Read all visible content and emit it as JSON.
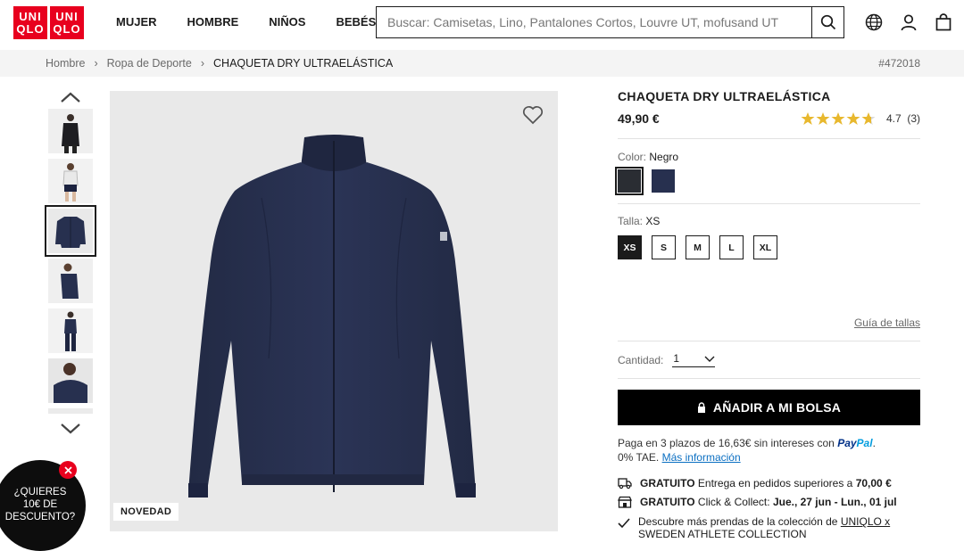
{
  "brand": {
    "line1": "UNI",
    "line2": "QLO",
    "line1_b": "UNI",
    "line2_b": "QLO",
    "color": "#e8001e"
  },
  "nav": [
    "MUJER",
    "HOMBRE",
    "NIÑOS",
    "BEBÉS"
  ],
  "search": {
    "placeholder": "Buscar: Camisetas, Lino, Pantalones Cortos, Louvre UT, mofusand UT"
  },
  "header_icons": [
    "globe-icon",
    "user-icon",
    "bag-icon"
  ],
  "breadcrumb": {
    "items": [
      "Hombre",
      "Ropa de Deporte",
      "CHAQUETA DRY ULTRAELÁSTICA"
    ],
    "code": "#472018"
  },
  "gallery": {
    "badge": "NOVEDAD",
    "selected_thumb": 3,
    "thumb_count": 7
  },
  "promo": {
    "line1": "¿QUIERES",
    "line2": "10€ DE",
    "line3": "DESCUENTO?"
  },
  "product": {
    "title": "CHAQUETA DRY ULTRAELÁSTICA",
    "price": "49,90 €",
    "rating": "4.7",
    "reviews": "(3)",
    "rating_value": 4.7,
    "color_label": "Color:",
    "color_value": "Negro",
    "colors": [
      "#2a2d33",
      "#27304f"
    ],
    "size_label": "Talla:",
    "size_value": "XS",
    "sizes": [
      "XS",
      "S",
      "M",
      "L",
      "XL"
    ],
    "size_guide": "Guía de tallas",
    "qty_label": "Cantidad:",
    "qty_value": "1",
    "add_button": "AÑADIR A MI BOLSA",
    "paypal_text": "Paga en 3 plazos de 16,63€ sin intereses con",
    "paypal_logo_a": "Pay",
    "paypal_logo_b": "Pal",
    "paypal_text2": "0% TAE.",
    "paypal_more": "Más información",
    "delivery1_bold": "GRATUITO",
    "delivery1_text": "Entrega en pedidos superiores a",
    "delivery1_amount": "70,00 €",
    "delivery2_bold": "GRATUITO",
    "delivery2_text": "Click & Collect:",
    "delivery2_dates": "Jue., 27 jun - Lun., 01 jul",
    "collection_text": "Descubre más prendas de la colección de",
    "collection_link": "UNIQLO x",
    "collection_link2": "SWEDEN ATHLETE COLLECTION"
  }
}
